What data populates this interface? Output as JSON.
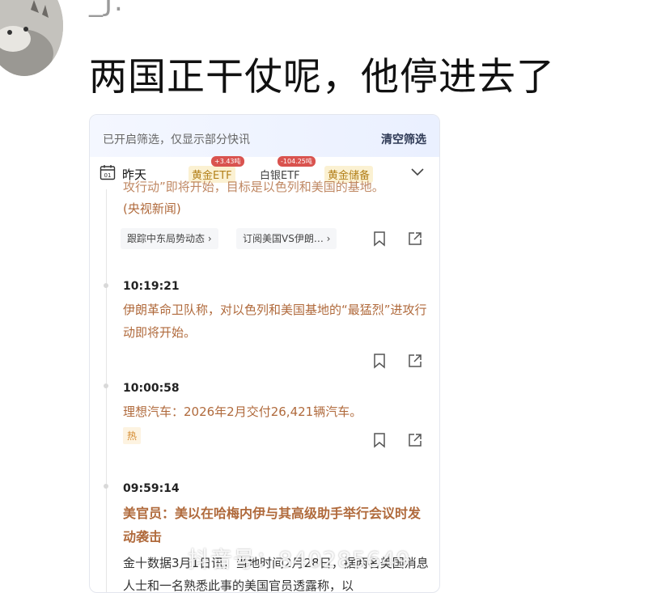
{
  "post": {
    "username": "_J.",
    "text": "两国正干仗呢，他停进去了"
  },
  "feed": {
    "filter_note": "已开启筛选，仅显示部分快讯",
    "clear_filter": "清空筛选",
    "day_label": "昨天",
    "calendar_day": "01",
    "chips": [
      {
        "label": "黄金ETF",
        "badge": "+3.43吨"
      },
      {
        "label": "白银ETF",
        "badge": "-104.25吨"
      },
      {
        "label": "黄金储备",
        "badge": ""
      }
    ],
    "fragment_top": "攻行动”即将开始，目标是以色列和美国的基地。",
    "fragment_source": "(央视新闻)",
    "tags": [
      "跟踪中东局势动态 ›",
      "订阅美国VS伊朗… ›"
    ],
    "items": [
      {
        "time": "10:19:21",
        "text": "伊朗革命卫队称，对以色列和美国基地的“最猛烈”进攻行动即将开始。"
      },
      {
        "time": "10:00:58",
        "text": "理想汽车：2026年2月交付26,421辆汽车。",
        "tag": "热"
      },
      {
        "time": "09:59:14",
        "title": "美官员：美以在哈梅内伊与其高级助手举行会议时发动袭击",
        "text": "金十数据3月1日讯，当地时间2月28日，据两名美国消息人士和一名熟悉此事的美国官员透露称，以"
      }
    ]
  },
  "watermark": "抖音号：840285649",
  "colors": {
    "accent_orange": "#b06a3c",
    "hot": "#d48a2e",
    "badge_red": "#d9534f",
    "gold_chip": "#fbf1d2"
  },
  "icons": [
    "calendar-icon",
    "chevron-down-icon",
    "bookmark-icon",
    "share-icon"
  ]
}
